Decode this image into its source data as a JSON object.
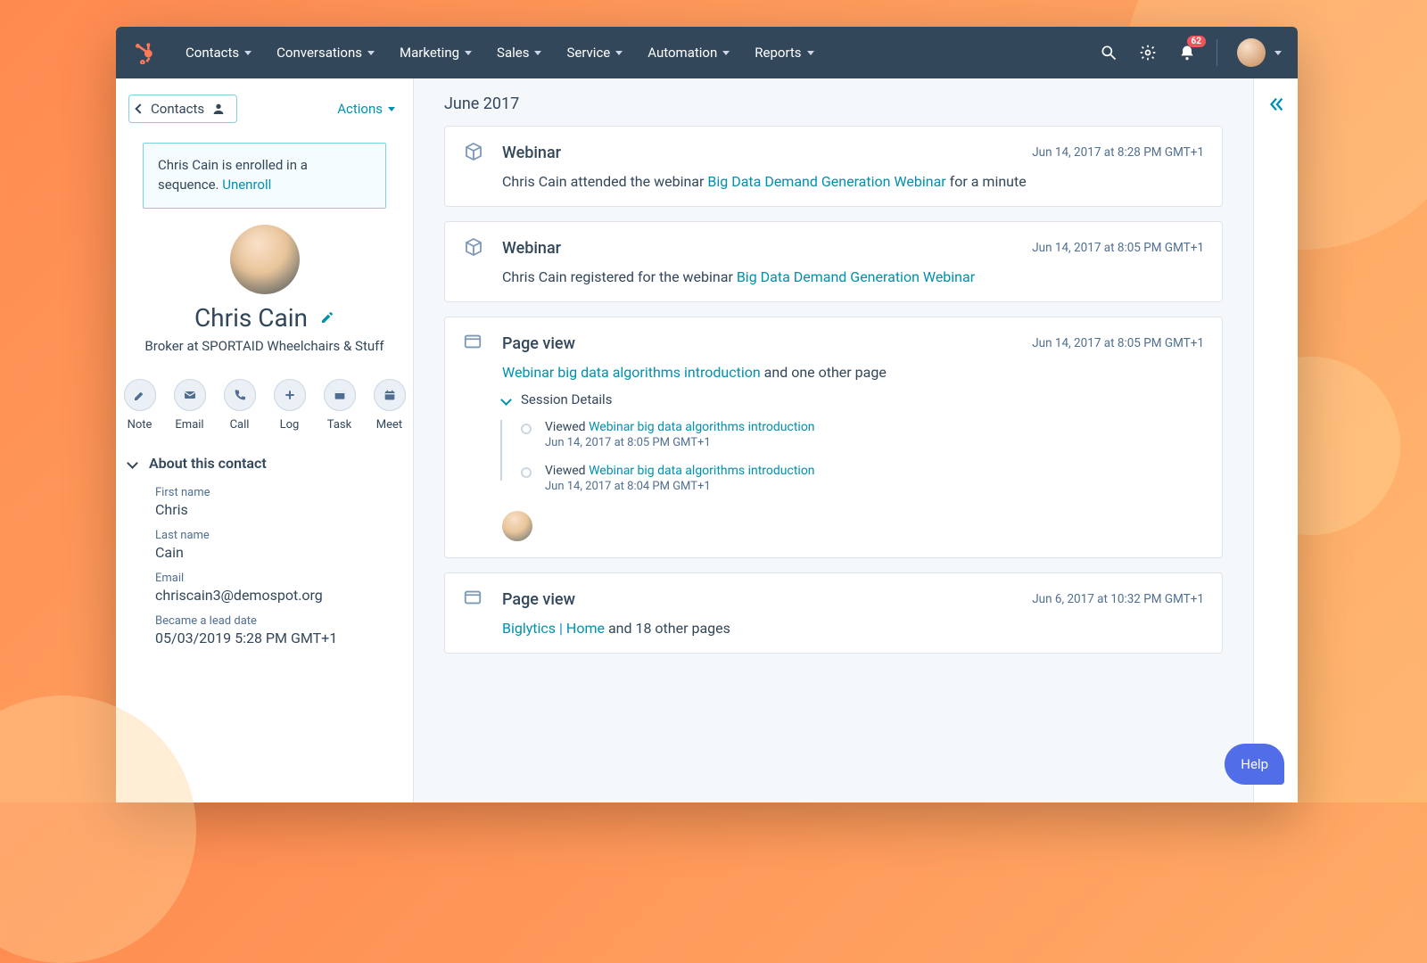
{
  "topnav": {
    "items": [
      "Contacts",
      "Conversations",
      "Marketing",
      "Sales",
      "Service",
      "Automation",
      "Reports"
    ],
    "notification_count": "62"
  },
  "sidebar": {
    "back_label": "Contacts",
    "actions_label": "Actions",
    "sequence_banner": {
      "text_before": "Chris Cain is enrolled in a sequence. ",
      "unenroll_label": "Unenroll"
    },
    "contact": {
      "name": "Chris Cain",
      "subtitle": "Broker at SPORTAID Wheelchairs & Stuff"
    },
    "actions": [
      "Note",
      "Email",
      "Call",
      "Log",
      "Task",
      "Meet"
    ],
    "about_section_title": "About this contact",
    "fields": [
      {
        "label": "First name",
        "value": "Chris"
      },
      {
        "label": "Last name",
        "value": "Cain"
      },
      {
        "label": "Email",
        "value": "chriscain3@demospot.org"
      },
      {
        "label": "Became a lead date",
        "value": "05/03/2019 5:28 PM GMT+1"
      }
    ]
  },
  "timeline": {
    "month_header": "June 2017",
    "events": [
      {
        "icon": "cube",
        "title": "Webinar",
        "timestamp": "Jun 14, 2017 at 8:28 PM GMT+1",
        "text_before": "Chris Cain attended the webinar ",
        "link_text": "Big Data Demand Generation Webinar",
        "text_after": " for a minute"
      },
      {
        "icon": "cube",
        "title": "Webinar",
        "timestamp": "Jun 14, 2017 at 8:05 PM GMT+1",
        "text_before": "Chris Cain registered for the webinar ",
        "link_text": "Big Data Demand Generation Webinar",
        "text_after": ""
      },
      {
        "icon": "browser",
        "title": "Page view",
        "timestamp": "Jun 14, 2017 at 8:05 PM GMT+1",
        "text_before": "",
        "link_text": "Webinar big data algorithms introduction",
        "text_after": " and one other page",
        "session_label": "Session Details",
        "session": [
          {
            "prefix": "Viewed ",
            "link": "Webinar big data algorithms introduction",
            "ts": "Jun 14, 2017 at 8:05 PM GMT+1"
          },
          {
            "prefix": "Viewed ",
            "link": "Webinar big data algorithms introduction",
            "ts": "Jun 14, 2017 at 8:04 PM GMT+1"
          }
        ]
      },
      {
        "icon": "browser",
        "title": "Page view",
        "timestamp": "Jun 6, 2017 at 10:32 PM GMT+1",
        "text_before": "",
        "link_text": "Biglytics | Home",
        "text_after": " and 18 other pages"
      }
    ]
  },
  "help_label": "Help"
}
